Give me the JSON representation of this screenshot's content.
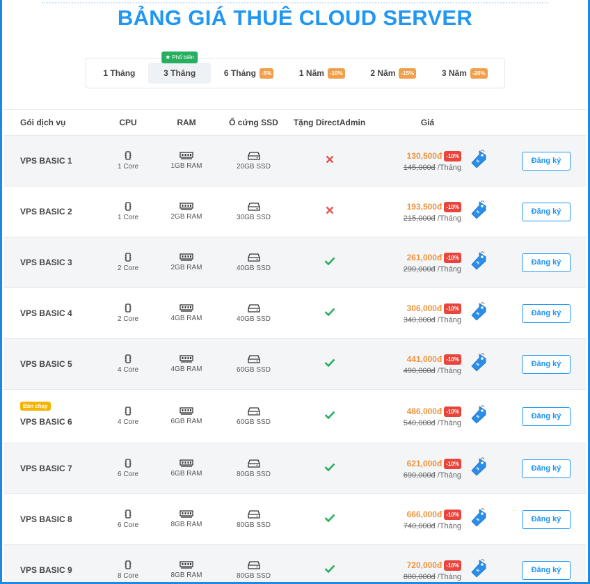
{
  "title": "BẢNG GIÁ THUÊ CLOUD SERVER",
  "tabs": [
    {
      "label": "1 Tháng",
      "discount": "",
      "active": false
    },
    {
      "label": "3 Tháng",
      "discount": "",
      "active": true,
      "badge": "Phổ biến"
    },
    {
      "label": "6 Tháng",
      "discount": "-5%",
      "active": false
    },
    {
      "label": "1 Năm",
      "discount": "-10%",
      "active": false
    },
    {
      "label": "2 Năm",
      "discount": "-15%",
      "active": false
    },
    {
      "label": "3 Năm",
      "discount": "-20%",
      "active": false
    }
  ],
  "headers": {
    "name": "Gói dịch vụ",
    "cpu": "CPU",
    "ram": "RAM",
    "ssd": "Ổ cứng SSD",
    "da": "Tặng DirectAdmin",
    "price": "Giá"
  },
  "colors": {
    "accent": "#2196f3",
    "price": "#f0923c",
    "discount": "#e8453c",
    "check": "#27ae60",
    "cross": "#e05555",
    "bestseller": "#f5b400"
  },
  "button_label": "Đăng ký",
  "period_suffix": "/Tháng",
  "plans": [
    {
      "name": "VPS BASIC 1",
      "cpu": "1 Core",
      "ram": "1GB RAM",
      "ssd": "20GB SSD",
      "directadmin": false,
      "price": "130,500đ",
      "discount": "-10%",
      "old_price": "145,000đ",
      "badge": ""
    },
    {
      "name": "VPS BASIC 2",
      "cpu": "1 Core",
      "ram": "2GB RAM",
      "ssd": "30GB SSD",
      "directadmin": false,
      "price": "193,500đ",
      "discount": "-10%",
      "old_price": "215,000đ",
      "badge": ""
    },
    {
      "name": "VPS BASIC 3",
      "cpu": "2 Core",
      "ram": "2GB RAM",
      "ssd": "40GB SSD",
      "directadmin": true,
      "price": "261,000đ",
      "discount": "-10%",
      "old_price": "290,000đ",
      "badge": ""
    },
    {
      "name": "VPS BASIC 4",
      "cpu": "2 Core",
      "ram": "4GB RAM",
      "ssd": "40GB SSD",
      "directadmin": true,
      "price": "306,000đ",
      "discount": "-10%",
      "old_price": "340,000đ",
      "badge": ""
    },
    {
      "name": "VPS BASIC 5",
      "cpu": "4 Core",
      "ram": "4GB RAM",
      "ssd": "60GB SSD",
      "directadmin": true,
      "price": "441,000đ",
      "discount": "-10%",
      "old_price": "490,000đ",
      "badge": ""
    },
    {
      "name": "VPS BASIC 6",
      "cpu": "4 Core",
      "ram": "6GB RAM",
      "ssd": "60GB SSD",
      "directadmin": true,
      "price": "486,000đ",
      "discount": "-10%",
      "old_price": "540,000đ",
      "badge": "Bán chạy"
    },
    {
      "name": "VPS BASIC 7",
      "cpu": "6 Core",
      "ram": "6GB RAM",
      "ssd": "80GB SSD",
      "directadmin": true,
      "price": "621,000đ",
      "discount": "-10%",
      "old_price": "690,000đ",
      "badge": ""
    },
    {
      "name": "VPS BASIC 8",
      "cpu": "6 Core",
      "ram": "8GB RAM",
      "ssd": "80GB SSD",
      "directadmin": true,
      "price": "666,000đ",
      "discount": "-10%",
      "old_price": "740,000đ",
      "badge": ""
    },
    {
      "name": "VPS BASIC 9",
      "cpu": "8 Core",
      "ram": "8GB RAM",
      "ssd": "80GB SSD",
      "directadmin": true,
      "price": "720,000đ",
      "discount": "-10%",
      "old_price": "800,000đ",
      "badge": ""
    }
  ]
}
